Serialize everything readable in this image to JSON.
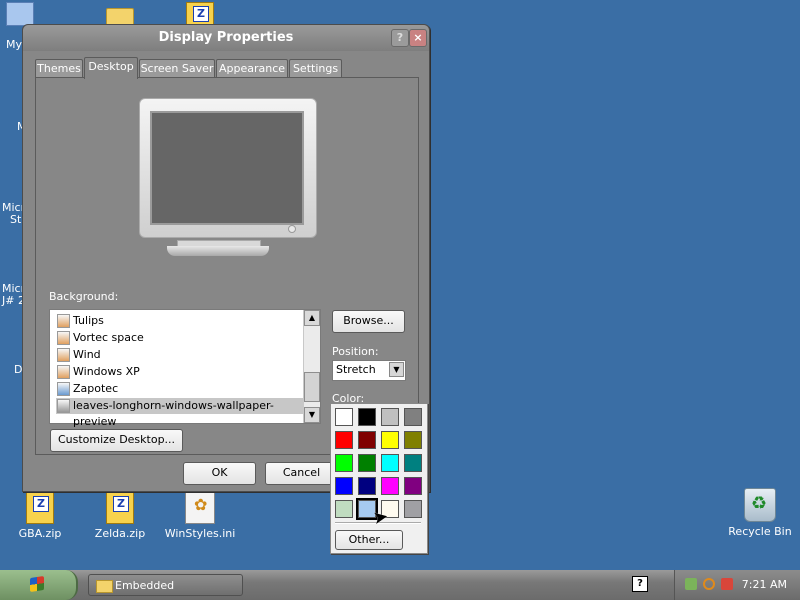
{
  "desktop": {
    "icons": [
      {
        "label": "GBA.zip"
      },
      {
        "label": "Zelda.zip"
      },
      {
        "label": "WinStyles.ini"
      },
      {
        "label": "Recycle Bin"
      }
    ],
    "partial_labels": [
      "My",
      "M",
      "Micr",
      "St",
      "Micr",
      "J# 2",
      "D"
    ]
  },
  "dialog": {
    "title": "Display Properties",
    "help_glyph": "?",
    "close_glyph": "×",
    "tabs": [
      "Themes",
      "Desktop",
      "Screen Saver",
      "Appearance",
      "Settings"
    ],
    "active_tab": "Desktop",
    "background_label": "Background:",
    "background_items": [
      {
        "label": "Tulips"
      },
      {
        "label": "Vortec space"
      },
      {
        "label": "Wind"
      },
      {
        "label": "Windows XP"
      },
      {
        "label": "Zapotec"
      },
      {
        "label": "leaves-longhorn-windows-wallpaper-preview",
        "selected": true
      }
    ],
    "browse_label": "Browse...",
    "position_label": "Position:",
    "position_value": "Stretch",
    "color_label": "Color:",
    "customize_label": "Customize Desktop...",
    "ok_label": "OK",
    "cancel_label": "Cancel"
  },
  "palette": {
    "colors": [
      "#ffffff",
      "#000000",
      "#c0c0c0",
      "#808080",
      "#ff0000",
      "#800000",
      "#ffff00",
      "#808000",
      "#00ff00",
      "#008000",
      "#00ffff",
      "#008080",
      "#0000ff",
      "#000080",
      "#ff00ff",
      "#800080",
      "#c0dcc0",
      "#a6caf0",
      "#fffbf0",
      "#a0a0a4"
    ],
    "selected_index": 17,
    "other_label": "Other..."
  },
  "taskbar": {
    "task_label": "Embedded",
    "clock": "7:21 AM",
    "help_glyph": "?"
  }
}
